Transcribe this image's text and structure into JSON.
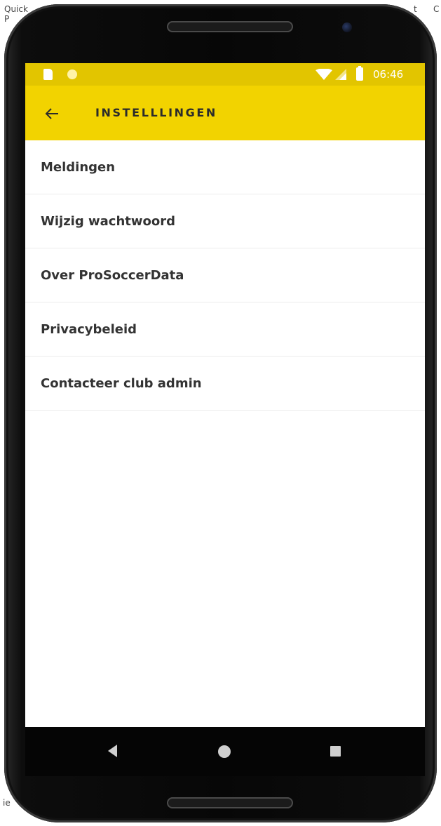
{
  "background": {
    "top_left_line1": "Quick",
    "top_left_line2": "P",
    "top_right_left": "t",
    "top_right_right": "C",
    "bottom_left_line1": "",
    "bottom_left_line2": "ie"
  },
  "status_bar": {
    "time": "06:46",
    "color": "#e2c500"
  },
  "app_bar": {
    "title": "INSTELLLINGEN",
    "back_icon": "arrow-left-icon",
    "color": "#f2d300"
  },
  "settings": {
    "items": [
      {
        "label": "Meldingen"
      },
      {
        "label": "Wijzig wachtwoord"
      },
      {
        "label": "Over ProSoccerData"
      },
      {
        "label": "Privacybeleid"
      },
      {
        "label": "Contacteer club admin"
      }
    ]
  },
  "nav_bar": {
    "back_icon": "triangle-back-icon",
    "home_icon": "circle-home-icon",
    "recent_icon": "square-recent-icon"
  }
}
